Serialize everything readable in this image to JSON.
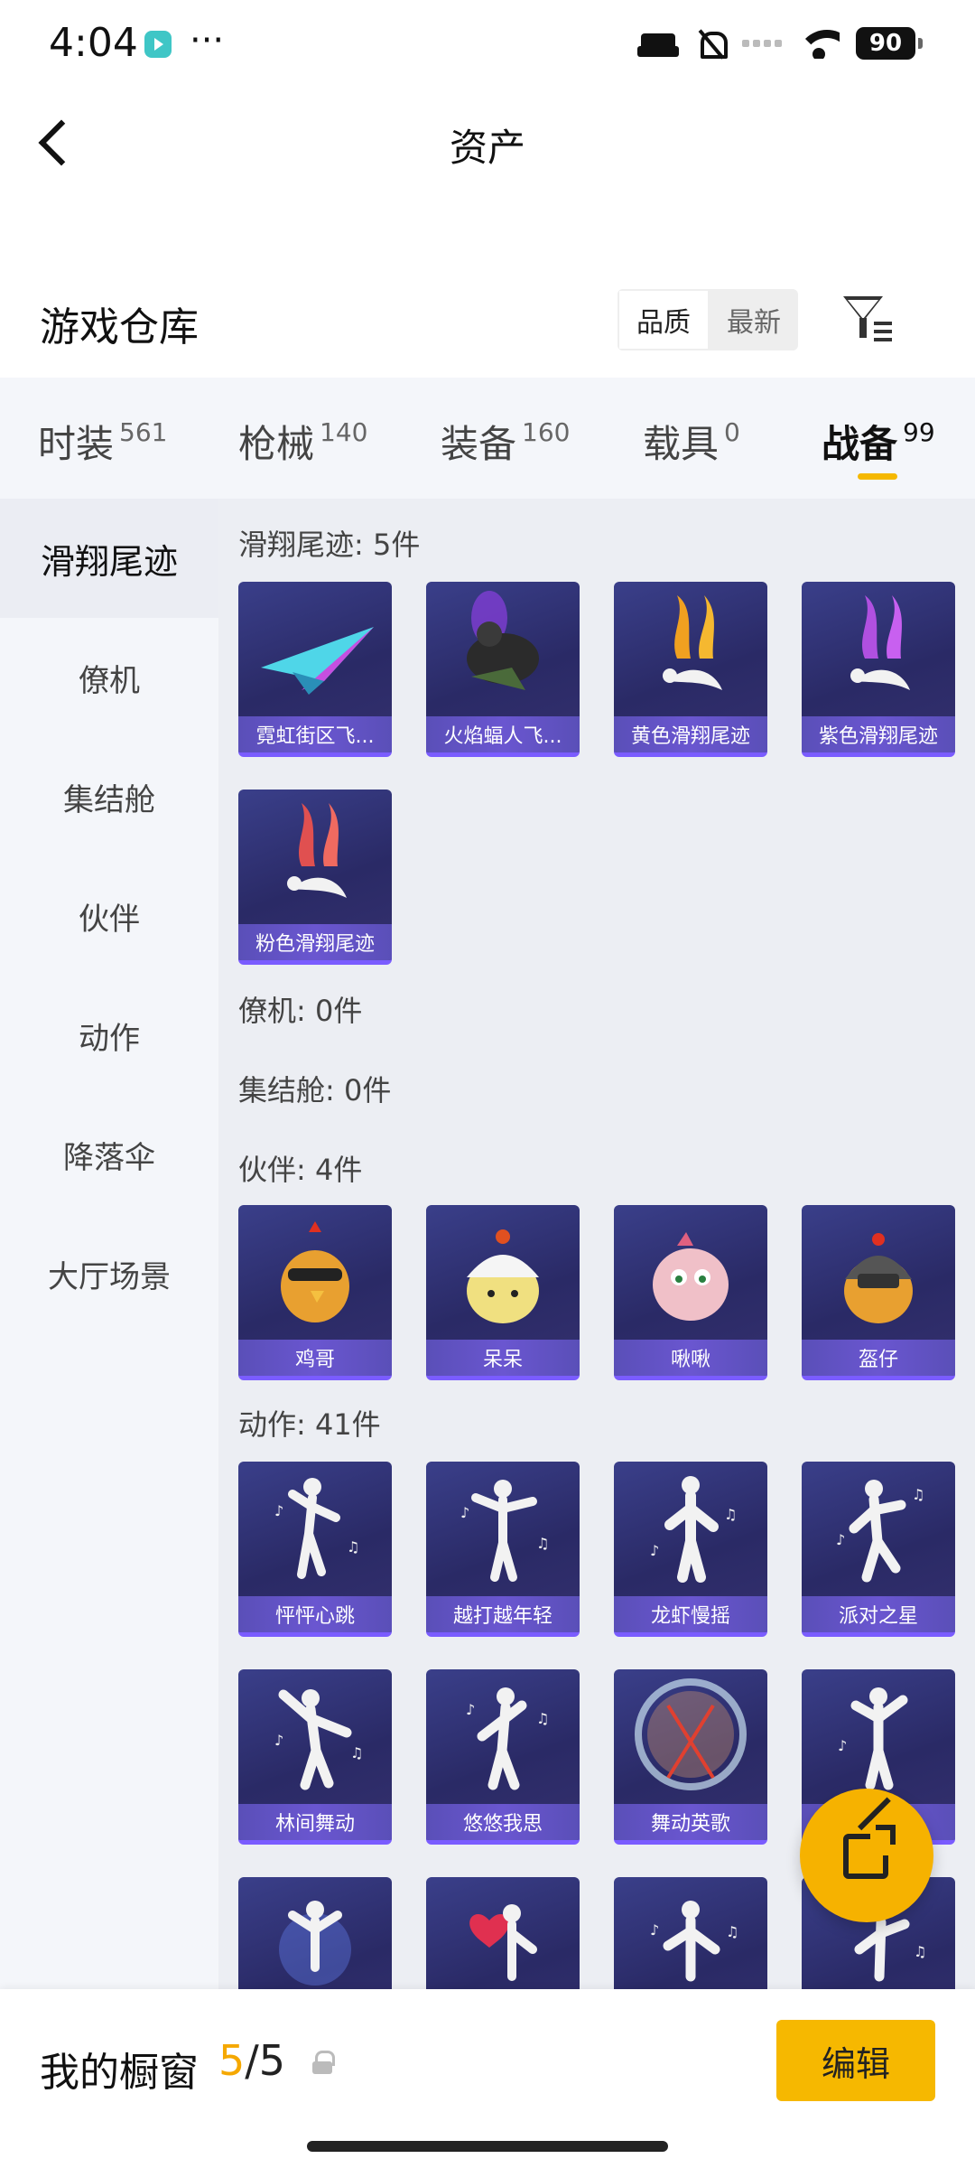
{
  "status_bar": {
    "time": "4:04",
    "dots": "···",
    "battery": "90"
  },
  "header": {
    "title": "资产"
  },
  "warehouse": {
    "title": "游戏仓库",
    "sort_options": [
      "品质",
      "最新"
    ]
  },
  "tabs": [
    {
      "label": "时装",
      "count": "561"
    },
    {
      "label": "枪械",
      "count": "140"
    },
    {
      "label": "装备",
      "count": "160"
    },
    {
      "label": "载具",
      "count": "0"
    },
    {
      "label": "战备",
      "count": "99"
    }
  ],
  "active_tab": "战备",
  "sidebar": [
    "滑翔尾迹",
    "僚机",
    "集结舱",
    "伙伴",
    "动作",
    "降落伞",
    "大厅场景"
  ],
  "sections": {
    "glide": {
      "title": "滑翔尾迹: 5件",
      "items": [
        "霓虹街区飞...",
        "火焰蝠人飞...",
        "黄色滑翔尾迹",
        "紫色滑翔尾迹",
        "粉色滑翔尾迹"
      ]
    },
    "wingman": {
      "title": "僚机: 0件"
    },
    "pod": {
      "title": "集结舱: 0件"
    },
    "partner": {
      "title": "伙伴: 4件",
      "items": [
        "鸡哥",
        "呆呆",
        "啾啾",
        "盔仔"
      ]
    },
    "emote": {
      "title": "动作: 41件",
      "items": [
        "怦怦心跳",
        "越打越年轻",
        "龙虾慢摇",
        "派对之星",
        "林间舞动",
        "悠悠我思",
        "舞动英歌",
        ""
      ]
    }
  },
  "showcase": {
    "title": "我的橱窗",
    "current": "5",
    "separator": "/",
    "max": "5",
    "edit_label": "编辑"
  },
  "colors": {
    "accent": "#f5b800",
    "card_bg": "#2a2a66",
    "card_label": "#5a4fb8"
  }
}
